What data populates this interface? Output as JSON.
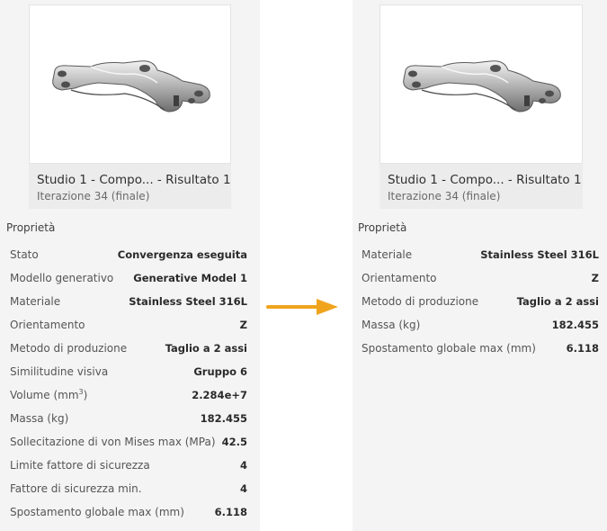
{
  "colors": {
    "arrow": "#f0a41e",
    "panel": "#f4f4f4"
  },
  "left": {
    "card": {
      "title": "Studio 1 - Compo...  - Risultato 1",
      "subtitle": "Iterazione 34 (finale)"
    },
    "section_title": "Proprietà",
    "properties": [
      {
        "label": "Stato",
        "value": "Convergenza eseguita"
      },
      {
        "label": "Modello generativo",
        "value": "Generative Model 1"
      },
      {
        "label": "Materiale",
        "value": "Stainless Steel 316L"
      },
      {
        "label": "Orientamento",
        "value": "Z"
      },
      {
        "label": "Metodo di produzione",
        "value": "Taglio a 2 assi"
      },
      {
        "label": "Similitudine visiva",
        "value": "Gruppo 6"
      },
      {
        "label": "Volume (mm",
        "label_sup": "3",
        "label_tail": ")",
        "value": "2.284e+7"
      },
      {
        "label": "Massa (kg)",
        "value": "182.455"
      },
      {
        "label": "Sollecitazione di von Mises max (MPa)",
        "value": "42.5"
      },
      {
        "label": "Limite fattore di sicurezza",
        "value": "4"
      },
      {
        "label": "Fattore di sicurezza min.",
        "value": "4"
      },
      {
        "label": "Spostamento globale max (mm)",
        "value": "6.118"
      }
    ]
  },
  "arrow_icon": "right-arrow-icon",
  "right": {
    "card": {
      "title": "Studio 1 - Compo...  - Risultato 1",
      "subtitle": "Iterazione 34 (finale)"
    },
    "section_title": "Proprietà",
    "properties": [
      {
        "label": "Materiale",
        "value": "Stainless Steel 316L"
      },
      {
        "label": "Orientamento",
        "value": "Z"
      },
      {
        "label": "Metodo di produzione",
        "value": "Taglio a 2 assi"
      },
      {
        "label": "Massa (kg)",
        "value": "182.455"
      },
      {
        "label": "Spostamento globale max (mm)",
        "value": "6.118"
      }
    ]
  }
}
